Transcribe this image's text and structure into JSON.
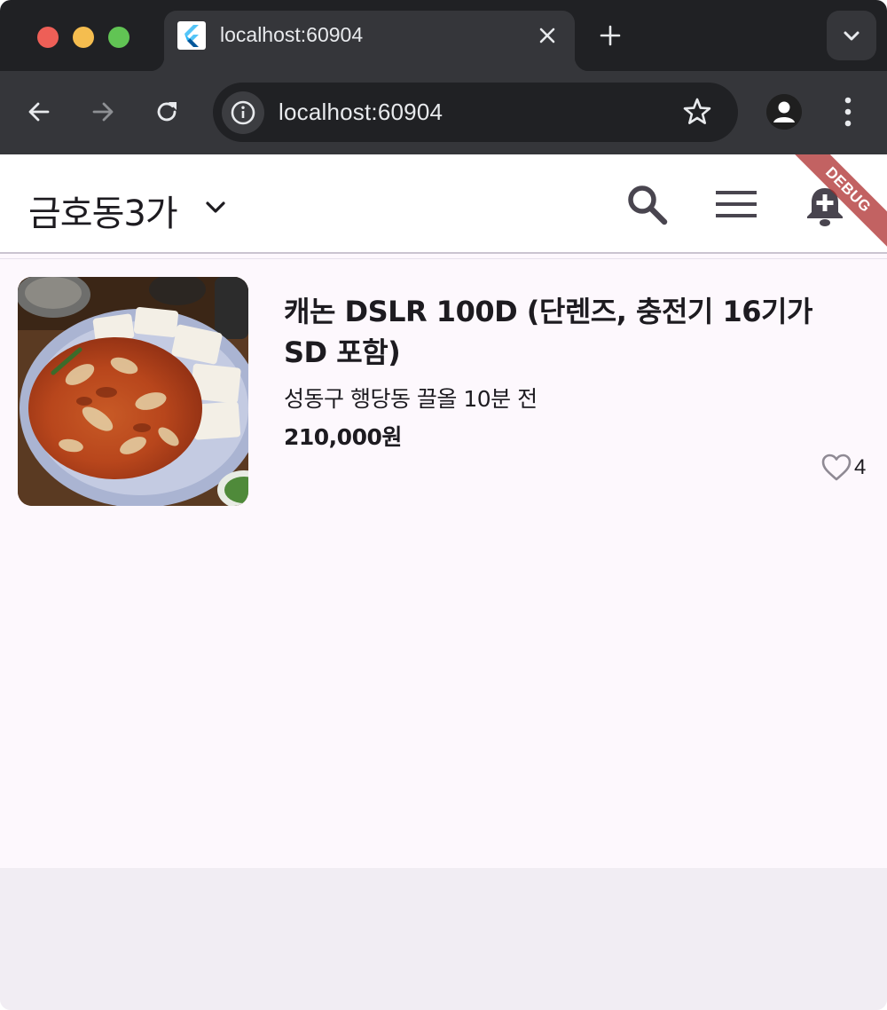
{
  "browser": {
    "tab_title": "localhost:60904",
    "url": "localhost:60904"
  },
  "appbar": {
    "location_title": "금호동3가",
    "debug_label": "DEBUG"
  },
  "items": [
    {
      "title": "캐논 DSLR 100D (단렌즈, 충전기 16기가 SD 포함)",
      "meta": "성동구 행당동 끌올 10분 전",
      "price": "210,000원",
      "likes": "4"
    }
  ],
  "colors": {
    "chrome_dark": "#202124",
    "chrome_tab": "#35363a",
    "app_background": "#fdf8fd",
    "text_primary": "#1d1b20",
    "debug_banner": "#ad2e2e"
  },
  "icons": {
    "tabbar": [
      "flutter-favicon-icon",
      "close-icon",
      "plus-icon",
      "chevron-down-icon"
    ],
    "toolbar": [
      "back-arrow-icon",
      "forward-arrow-icon",
      "reload-icon",
      "info-icon",
      "star-icon",
      "profile-icon",
      "kebab-menu-icon"
    ],
    "appbar": [
      "chevron-down-icon",
      "search-icon",
      "hamburger-menu-icon",
      "notification-add-icon"
    ],
    "item": [
      "heart-outline-icon"
    ]
  }
}
